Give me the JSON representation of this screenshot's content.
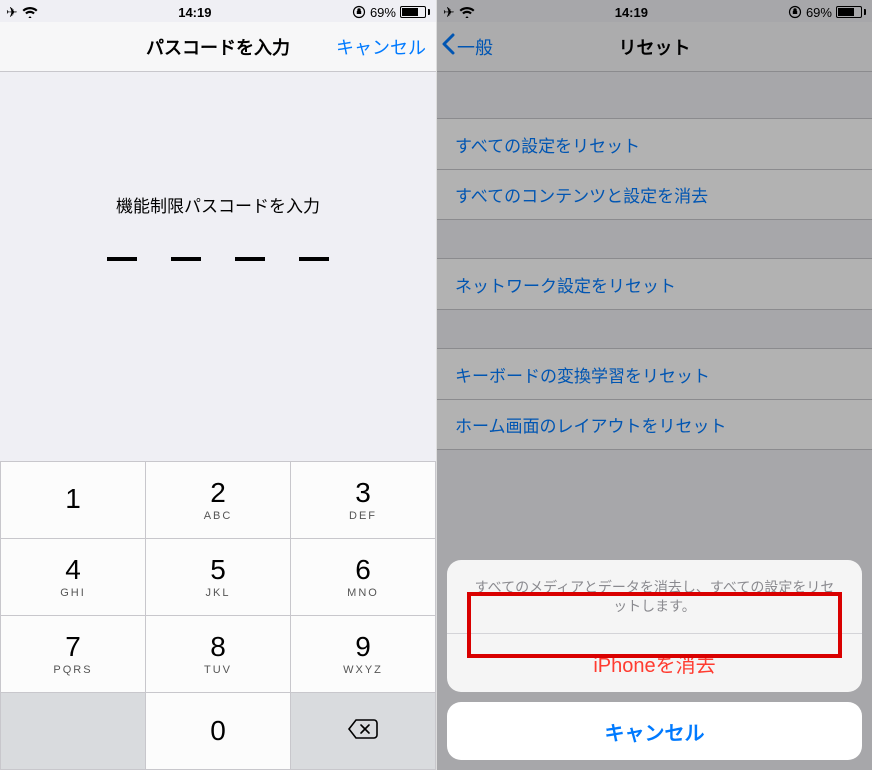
{
  "status": {
    "time": "14:19",
    "battery_pct": "69%"
  },
  "left": {
    "nav_title": "パスコードを入力",
    "cancel": "キャンセル",
    "prompt": "機能制限パスコードを入力",
    "keypad": {
      "k1": "1",
      "k1l": "",
      "k2": "2",
      "k2l": "ABC",
      "k3": "3",
      "k3l": "DEF",
      "k4": "4",
      "k4l": "GHI",
      "k5": "5",
      "k5l": "JKL",
      "k6": "6",
      "k6l": "MNO",
      "k7": "7",
      "k7l": "PQRS",
      "k8": "8",
      "k8l": "TUV",
      "k9": "9",
      "k9l": "WXYZ",
      "k0": "0"
    }
  },
  "right": {
    "nav_title": "リセット",
    "back_label": "一般",
    "rows": {
      "r0": "すべての設定をリセット",
      "r1": "すべてのコンテンツと設定を消去",
      "r2": "ネットワーク設定をリセット",
      "r3": "キーボードの変換学習をリセット",
      "r4": "ホーム画面のレイアウトをリセット"
    },
    "sheet": {
      "message": "すべてのメディアとデータを消去し、すべての設定をリセットします。",
      "destructive": "iPhoneを消去",
      "cancel": "キャンセル"
    }
  }
}
